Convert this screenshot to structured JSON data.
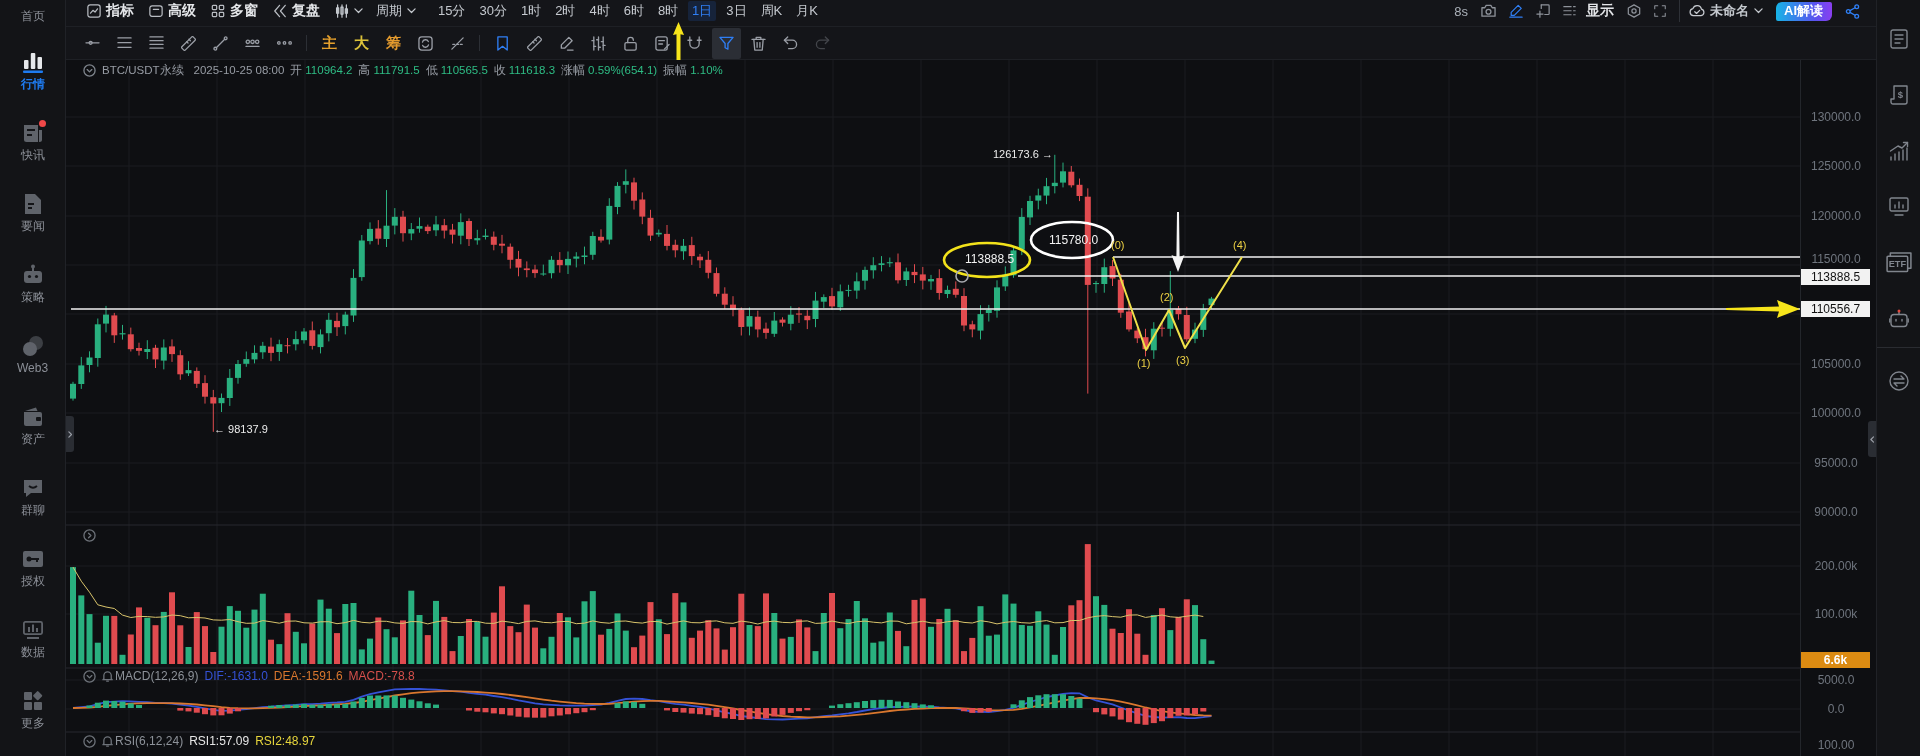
{
  "sidebar": {
    "top_cut_label": "首页",
    "items": [
      {
        "label": "行情",
        "selected": true,
        "notify": false
      },
      {
        "label": "快讯",
        "selected": false,
        "notify": true
      },
      {
        "label": "要闻",
        "selected": false,
        "notify": false
      },
      {
        "label": "策略",
        "selected": false,
        "notify": false
      },
      {
        "label": "Web3",
        "selected": false,
        "notify": false
      },
      {
        "label": "资产",
        "selected": false,
        "notify": false
      },
      {
        "label": "群聊",
        "selected": false,
        "notify": false
      },
      {
        "label": "授权",
        "selected": false,
        "notify": false
      },
      {
        "label": "数据",
        "selected": false,
        "notify": false
      },
      {
        "label": "更多",
        "selected": false,
        "notify": false
      }
    ]
  },
  "top_bar": {
    "tools": [
      {
        "label": "指标"
      },
      {
        "label": "高级"
      },
      {
        "label": "多窗"
      },
      {
        "label": "复盘"
      }
    ],
    "period_menu": "周期",
    "periods": [
      {
        "label": "15分",
        "selected": false
      },
      {
        "label": "30分",
        "selected": false
      },
      {
        "label": "1时",
        "selected": false
      },
      {
        "label": "2时",
        "selected": false
      },
      {
        "label": "4时",
        "selected": false
      },
      {
        "label": "6时",
        "selected": false
      },
      {
        "label": "8时",
        "selected": false
      },
      {
        "label": "1日",
        "selected": true
      },
      {
        "label": "3日",
        "selected": false
      },
      {
        "label": "周K",
        "selected": false
      },
      {
        "label": "月K",
        "selected": false
      }
    ],
    "refresh": "8s",
    "pen_active": true,
    "display": "显示",
    "layout_name": "未命名",
    "ai_button": "AI解读"
  },
  "drawing_toolbar": {
    "groups": [
      [
        {
          "kind": "icon",
          "on": false,
          "selected": false,
          "disabled": false
        },
        {
          "kind": "icon",
          "on": false,
          "selected": false,
          "disabled": false
        },
        {
          "kind": "icon",
          "on": false,
          "selected": false,
          "disabled": false
        },
        {
          "kind": "icon",
          "on": false,
          "selected": false,
          "disabled": false
        },
        {
          "kind": "icon",
          "on": false,
          "selected": false,
          "disabled": false
        },
        {
          "kind": "icon",
          "on": false,
          "selected": false,
          "disabled": false
        },
        {
          "kind": "icon",
          "on": false,
          "selected": false,
          "disabled": false
        }
      ],
      [
        {
          "kind": "text",
          "label": "主",
          "color": "#e5a02c",
          "on": false,
          "selected": false,
          "disabled": false
        },
        {
          "kind": "text",
          "label": "大",
          "color": "#dcc23a",
          "on": false,
          "selected": false,
          "disabled": false
        },
        {
          "kind": "text",
          "label": "筹",
          "color": "#e39a2e",
          "on": false,
          "selected": false,
          "disabled": false
        },
        {
          "kind": "icon",
          "on": false,
          "selected": false,
          "disabled": false
        },
        {
          "kind": "icon",
          "on": false,
          "selected": false,
          "disabled": false
        }
      ],
      [
        {
          "kind": "icon",
          "on": true,
          "selected": false,
          "disabled": false
        },
        {
          "kind": "icon",
          "on": false,
          "selected": false,
          "disabled": false
        },
        {
          "kind": "icon",
          "on": false,
          "selected": false,
          "disabled": false
        },
        {
          "kind": "icon",
          "on": false,
          "selected": false,
          "disabled": false
        },
        {
          "kind": "icon",
          "on": false,
          "selected": false,
          "disabled": false
        },
        {
          "kind": "icon",
          "on": false,
          "selected": false,
          "disabled": false
        },
        {
          "kind": "icon",
          "on": false,
          "selected": false,
          "disabled": false
        },
        {
          "kind": "icon",
          "on": true,
          "selected": true,
          "disabled": false
        },
        {
          "kind": "icon",
          "on": false,
          "selected": false,
          "disabled": false
        },
        {
          "kind": "icon",
          "on": false,
          "selected": false,
          "disabled": false
        },
        {
          "kind": "icon",
          "on": false,
          "selected": false,
          "disabled": true
        }
      ]
    ]
  },
  "chart": {
    "legend": {
      "symbol": "BTC/USDT永续",
      "time": "2025-10-25 08:00",
      "rising": true,
      "fields": [
        {
          "label": "开",
          "value": "110964.2"
        },
        {
          "label": "高",
          "value": "111791.5"
        },
        {
          "label": "低",
          "value": "110565.5"
        },
        {
          "label": "收",
          "value": "111618.3"
        },
        {
          "label": "涨幅",
          "value": "0.59%(654.1)"
        },
        {
          "label": "振幅",
          "value": "1.10%"
        }
      ]
    },
    "high_label": "126173.6 →",
    "low_label": "← 98137.9",
    "circled_labels": [
      {
        "text": "113888.5",
        "color": "#f2e21b"
      },
      {
        "text": "115780.0",
        "color": "#ffffff"
      }
    ],
    "wave_labels": [
      "(0)",
      "(1)",
      "(2)",
      "(3)",
      "(4)"
    ],
    "price_axis": [
      "130000.0",
      "125000.0",
      "120000.0",
      "115000.0",
      "105000.0",
      "100000.0",
      "95000.0",
      "90000.0"
    ],
    "price_tags": [
      "113888.5",
      "110556.7"
    ]
  },
  "volume": {
    "axis": [
      "200.00k",
      "100.00k"
    ],
    "current": "6.6k"
  },
  "macd": {
    "title": "MACD(12,26,9)",
    "values": [
      {
        "text": "DIF:-1631.0",
        "color": "#3552d6"
      },
      {
        "text": "DEA:-1591.6",
        "color": "#d9772e"
      },
      {
        "text": "MACD:-78.8",
        "color": "#d6504c"
      }
    ],
    "axis": [
      "5000.0",
      "0.0"
    ]
  },
  "rsi": {
    "title": "RSI(6,12,24)",
    "values": [
      {
        "text": "RSI1:57.09",
        "color": "#e6e6e6"
      },
      {
        "text": "RSI2:48.97",
        "color": "#e6d53c"
      }
    ],
    "axis": [
      "100.00"
    ]
  },
  "right_sidebar": {
    "dollar_symbol": "$",
    "etf_badge": "ETF"
  }
}
